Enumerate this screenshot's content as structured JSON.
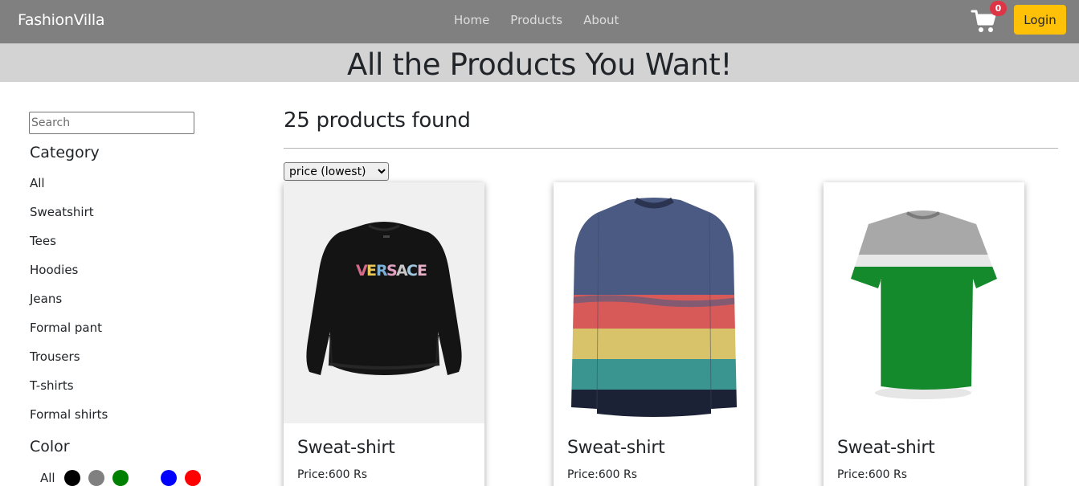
{
  "navbar": {
    "brand": "FashionVilla",
    "links": [
      "Home",
      "Products",
      "About"
    ],
    "cart_count": "0",
    "login_label": "Login"
  },
  "banner": {
    "title": "All the Products You Want!"
  },
  "sidebar": {
    "search_placeholder": "Search",
    "category_heading": "Category",
    "categories": [
      "All",
      "Sweatshirt",
      "Tees",
      "Hoodies",
      "Jeans",
      "Formal pant",
      "Trousers",
      "T-shirts",
      "Formal shirts"
    ],
    "color_heading": "Color",
    "color_all_label": "All",
    "colors": [
      "#000000",
      "#808080",
      "#008000",
      "#ffffff",
      "#0000ff",
      "#ff0000"
    ]
  },
  "main": {
    "products_found": "25 products found",
    "sort_selected": "price (lowest)",
    "products": [
      {
        "title": "Sweat-shirt",
        "price": "Price:600 Rs",
        "image": "black-versace-sweatshirt"
      },
      {
        "title": "Sweat-shirt",
        "price": "Price:600 Rs",
        "image": "striped-sweatshirt"
      },
      {
        "title": "Sweat-shirt",
        "price": "Price:600 Rs",
        "image": "green-grey-tshirt"
      }
    ]
  }
}
